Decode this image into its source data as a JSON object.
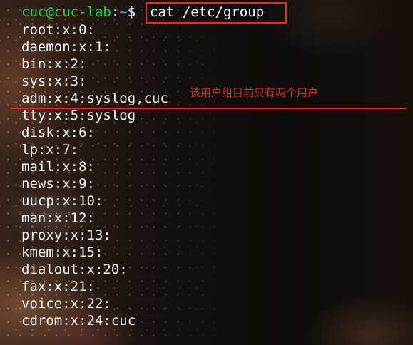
{
  "terminal": {
    "prompt": {
      "user_host": "cuc@cuc-lab",
      "separator": ":",
      "path": "~",
      "symbol": "$"
    },
    "command": "cat /etc/group",
    "output_lines": [
      "root:x:0:",
      "daemon:x:1:",
      "bin:x:2:",
      "sys:x:3:",
      "adm:x:4:syslog,cuc",
      "tty:x:5:syslog",
      "disk:x:6:",
      "lp:x:7:",
      "mail:x:8:",
      "news:x:9:",
      "uucp:x:10:",
      "man:x:12:",
      "proxy:x:13:",
      "kmem:x:15:",
      "dialout:x:20:",
      "fax:x:21:",
      "voice:x:22:",
      "cdrom:x:24:cuc"
    ]
  },
  "annotation": {
    "text": "该用户组目前只有两个用户",
    "color": "#e0301e"
  },
  "colors": {
    "prompt_user": "#22d04a",
    "prompt_path": "#5c8fff",
    "text": "#f2f2f2"
  }
}
